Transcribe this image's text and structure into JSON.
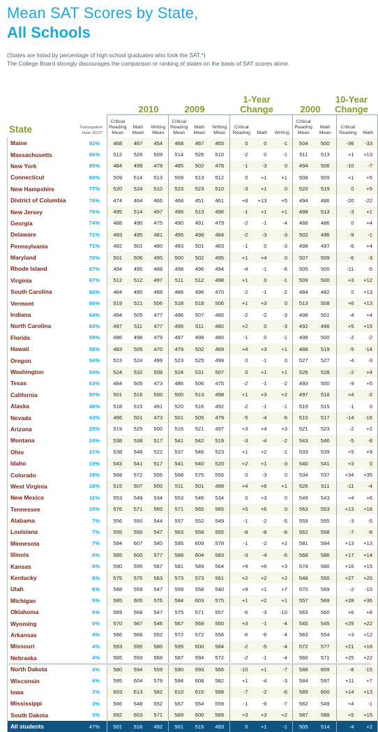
{
  "header": {
    "title_line1": "Mean SAT Scores by State,",
    "title_line2": "All Schools",
    "note_line1": "(States are listed by percentage of high school graduates who took the SAT.*)",
    "note_line2": "The College Board strongly discourages the comparison or ranking of states on the basis of SAT scores alone."
  },
  "colors": {
    "title": "#1aa8e0",
    "group_header": "#8a9a2a",
    "state_name": "#7a2315",
    "participation": "#1aa8e0",
    "total_row_bg": "#0f5584",
    "shade_row_bg": "#f6f7e9"
  },
  "table": {
    "group_headers": {
      "y2010": "2010",
      "y2009": "2009",
      "change1_line1": "1-Year",
      "change1_line2": "Change",
      "y2000": "2000",
      "change10_line1": "10-Year",
      "change10_line2": "Change"
    },
    "state_header": "State",
    "participation_header_line1": "Participation",
    "participation_header_line2": "Rate 2010*",
    "columns": {
      "cr_mean": [
        "Critical",
        "Reading",
        "Mean"
      ],
      "math_mean": [
        "Math",
        "Mean"
      ],
      "writing_mean": [
        "Writing",
        "Mean"
      ],
      "cr": [
        "Critical",
        "Reading"
      ],
      "math": "Math",
      "writing": "Writing"
    },
    "rows": [
      {
        "state": "Maine",
        "rate": "92%",
        "v": [
          "468",
          "467",
          "454",
          "468",
          "467",
          "455",
          "0",
          "0",
          "-1",
          "504",
          "500",
          "-36",
          "-33"
        ]
      },
      {
        "state": "Massachusetts",
        "rate": "86%",
        "v": [
          "512",
          "526",
          "509",
          "514",
          "526",
          "510",
          "-2",
          "0",
          "-1",
          "511",
          "513",
          "+1",
          "+13"
        ]
      },
      {
        "state": "New York",
        "rate": "85%",
        "v": [
          "484",
          "499",
          "478",
          "485",
          "502",
          "478",
          "-1",
          "-3",
          "0",
          "494",
          "506",
          "-10",
          "-7"
        ]
      },
      {
        "state": "Connecticut",
        "rate": "84%",
        "v": [
          "509",
          "514",
          "513",
          "509",
          "513",
          "512",
          "0",
          "+1",
          "+1",
          "508",
          "509",
          "+1",
          "+5"
        ]
      },
      {
        "state": "New Hampshire",
        "rate": "77%",
        "v": [
          "520",
          "524",
          "510",
          "523",
          "523",
          "510",
          "-3",
          "+1",
          "0",
          "520",
          "519",
          "0",
          "+5"
        ]
      },
      {
        "state": "District of Columbia",
        "rate": "76%",
        "v": [
          "474",
          "464",
          "466",
          "468",
          "451",
          "461",
          "+8",
          "+13",
          "+5",
          "494",
          "486",
          "-20",
          "-22"
        ]
      },
      {
        "state": "New Jersey",
        "rate": "76%",
        "v": [
          "495",
          "514",
          "497",
          "496",
          "513",
          "496",
          "-1",
          "+1",
          "+1",
          "498",
          "513",
          "-3",
          "+1"
        ]
      },
      {
        "state": "Georgia",
        "rate": "74%",
        "v": [
          "488",
          "490",
          "475",
          "490",
          "491",
          "479",
          "-2",
          "-1",
          "-4",
          "488",
          "486",
          "0",
          "+4"
        ]
      },
      {
        "state": "Delaware",
        "rate": "71%",
        "v": [
          "493",
          "495",
          "481",
          "495",
          "498",
          "484",
          "-2",
          "-3",
          "-3",
          "502",
          "496",
          "-9",
          "-1"
        ]
      },
      {
        "state": "Pennsylvania",
        "rate": "71%",
        "v": [
          "492",
          "501",
          "480",
          "493",
          "501",
          "483",
          "-1",
          "0",
          "-3",
          "498",
          "497",
          "-6",
          "+4"
        ]
      },
      {
        "state": "Maryland",
        "rate": "70%",
        "v": [
          "501",
          "506",
          "495",
          "500",
          "502",
          "495",
          "+1",
          "+4",
          "0",
          "507",
          "509",
          "-6",
          "-3"
        ]
      },
      {
        "state": "Rhode Island",
        "rate": "67%",
        "v": [
          "494",
          "495",
          "488",
          "498",
          "496",
          "494",
          "-4",
          "-1",
          "-6",
          "505",
          "500",
          "-11",
          "-5"
        ]
      },
      {
        "state": "Virginia",
        "rate": "67%",
        "v": [
          "512",
          "512",
          "497",
          "511",
          "512",
          "498",
          "+1",
          "0",
          "-1",
          "509",
          "500",
          "+3",
          "+12"
        ]
      },
      {
        "state": "South Carolina",
        "rate": "66%",
        "v": [
          "484",
          "495",
          "468",
          "486",
          "496",
          "470",
          "-2",
          "-1",
          "-2",
          "484",
          "482",
          "0",
          "+13"
        ]
      },
      {
        "state": "Vermont",
        "rate": "66%",
        "v": [
          "519",
          "521",
          "506",
          "518",
          "518",
          "506",
          "+1",
          "+3",
          "0",
          "513",
          "508",
          "+6",
          "+13"
        ]
      },
      {
        "state": "Indiana",
        "rate": "64%",
        "v": [
          "494",
          "505",
          "477",
          "496",
          "507",
          "480",
          "-2",
          "-2",
          "-3",
          "498",
          "501",
          "-4",
          "+4"
        ]
      },
      {
        "state": "North Carolina",
        "rate": "63%",
        "v": [
          "497",
          "511",
          "477",
          "495",
          "511",
          "480",
          "+2",
          "0",
          "-3",
          "492",
          "496",
          "+5",
          "+15"
        ]
      },
      {
        "state": "Florida",
        "rate": "59%",
        "v": [
          "496",
          "498",
          "479",
          "497",
          "498",
          "480",
          "-1",
          "0",
          "-1",
          "498",
          "500",
          "-2",
          "-2"
        ]
      },
      {
        "state": "Hawaii",
        "rate": "58%",
        "v": [
          "483",
          "505",
          "470",
          "479",
          "502",
          "469",
          "+4",
          "+3",
          "+1",
          "488",
          "519",
          "-5",
          "-14"
        ]
      },
      {
        "state": "Oregon",
        "rate": "54%",
        "v": [
          "523",
          "524",
          "499",
          "523",
          "525",
          "499",
          "0",
          "-1",
          "0",
          "527",
          "527",
          "-4",
          "-3"
        ]
      },
      {
        "state": "Washington",
        "rate": "54%",
        "v": [
          "524",
          "532",
          "508",
          "524",
          "531",
          "507",
          "0",
          "+1",
          "+1",
          "526",
          "528",
          "-2",
          "+4"
        ]
      },
      {
        "state": "Texas",
        "rate": "53%",
        "v": [
          "484",
          "505",
          "473",
          "486",
          "506",
          "475",
          "-2",
          "-1",
          "-2",
          "493",
          "500",
          "-9",
          "+5"
        ]
      },
      {
        "state": "California",
        "rate": "50%",
        "v": [
          "501",
          "516",
          "500",
          "500",
          "513",
          "498",
          "+1",
          "+3",
          "+2",
          "497",
          "518",
          "+4",
          "-2"
        ]
      },
      {
        "state": "Alaska",
        "rate": "48%",
        "v": [
          "518",
          "515",
          "491",
          "520",
          "516",
          "492",
          "-2",
          "-1",
          "-1",
          "519",
          "515",
          "-1",
          "0"
        ]
      },
      {
        "state": "Nevada",
        "rate": "43%",
        "v": [
          "496",
          "501",
          "473",
          "501",
          "505",
          "479",
          "-5",
          "-4",
          "-6",
          "510",
          "517",
          "-14",
          "-16"
        ]
      },
      {
        "state": "Arizona",
        "rate": "25%",
        "v": [
          "519",
          "525",
          "500",
          "516",
          "521",
          "497",
          "+3",
          "+4",
          "+3",
          "521",
          "523",
          "-2",
          "+2"
        ]
      },
      {
        "state": "Montana",
        "rate": "24%",
        "v": [
          "538",
          "538",
          "517",
          "541",
          "542",
          "519",
          "-3",
          "-4",
          "-2",
          "543",
          "546",
          "-5",
          "-8"
        ]
      },
      {
        "state": "Ohio",
        "rate": "21%",
        "v": [
          "538",
          "548",
          "522",
          "537",
          "546",
          "523",
          "+1",
          "+2",
          "-1",
          "533",
          "539",
          "+5",
          "+9"
        ]
      },
      {
        "state": "Idaho",
        "rate": "19%",
        "v": [
          "543",
          "541",
          "517",
          "541",
          "540",
          "520",
          "+2",
          "+1",
          "-3",
          "540",
          "541",
          "+3",
          "0"
        ]
      },
      {
        "state": "Colorado",
        "rate": "18%",
        "v": [
          "568",
          "572",
          "555",
          "568",
          "575",
          "555",
          "0",
          "-3",
          "0",
          "534",
          "537",
          "+34",
          "+35"
        ]
      },
      {
        "state": "West Virginia",
        "rate": "16%",
        "v": [
          "515",
          "507",
          "500",
          "511",
          "501",
          "499",
          "+4",
          "+6",
          "+1",
          "526",
          "511",
          "-11",
          "-4"
        ]
      },
      {
        "state": "New Mexico",
        "rate": "11%",
        "v": [
          "553",
          "549",
          "534",
          "553",
          "546",
          "534",
          "0",
          "+3",
          "0",
          "549",
          "543",
          "+4",
          "+6"
        ]
      },
      {
        "state": "Tennessee",
        "rate": "10%",
        "v": [
          "576",
          "571",
          "565",
          "571",
          "565",
          "565",
          "+5",
          "+6",
          "0",
          "563",
          "553",
          "+13",
          "+18"
        ]
      },
      {
        "state": "Alabama",
        "rate": "7%",
        "v": [
          "556",
          "550",
          "544",
          "557",
          "552",
          "549",
          "-1",
          "-2",
          "-5",
          "559",
          "555",
          "-3",
          "-5"
        ]
      },
      {
        "state": "Louisiana",
        "rate": "7%",
        "v": [
          "555",
          "550",
          "547",
          "563",
          "558",
          "555",
          "-8",
          "-8",
          "-8",
          "562",
          "558",
          "-7",
          "-8"
        ]
      },
      {
        "state": "Minnesota",
        "rate": "7%",
        "v": [
          "594",
          "607",
          "580",
          "595",
          "609",
          "578",
          "-1",
          "-2",
          "+2",
          "581",
          "594",
          "+13",
          "+13"
        ]
      },
      {
        "state": "Illinois",
        "rate": "6%",
        "v": [
          "585",
          "600",
          "577",
          "588",
          "604",
          "583",
          "-3",
          "-4",
          "-6",
          "568",
          "586",
          "+17",
          "+14"
        ]
      },
      {
        "state": "Kansas",
        "rate": "6%",
        "v": [
          "590",
          "595",
          "567",
          "581",
          "589",
          "564",
          "+9",
          "+6",
          "+3",
          "574",
          "580",
          "+16",
          "+15"
        ]
      },
      {
        "state": "Kentucky",
        "rate": "6%",
        "v": [
          "575",
          "575",
          "563",
          "573",
          "573",
          "561",
          "+2",
          "+2",
          "+2",
          "548",
          "550",
          "+27",
          "+25"
        ]
      },
      {
        "state": "Utah",
        "rate": "6%",
        "v": [
          "568",
          "559",
          "547",
          "559",
          "558",
          "540",
          "+9",
          "+1",
          "+7",
          "570",
          "569",
          "-2",
          "-10"
        ]
      },
      {
        "state": "Michigan",
        "rate": "5%",
        "v": [
          "585",
          "605",
          "576",
          "584",
          "603",
          "575",
          "+1",
          "+2",
          "+1",
          "557",
          "569",
          "+28",
          "+36"
        ]
      },
      {
        "state": "Oklahoma",
        "rate": "5%",
        "v": [
          "569",
          "568",
          "547",
          "575",
          "571",
          "557",
          "-6",
          "-3",
          "-10",
          "563",
          "560",
          "+6",
          "+8"
        ]
      },
      {
        "state": "Wyoming",
        "rate": "5%",
        "v": [
          "570",
          "567",
          "546",
          "567",
          "568",
          "550",
          "+3",
          "-1",
          "-4",
          "545",
          "545",
          "+25",
          "+22"
        ]
      },
      {
        "state": "Arkansas",
        "rate": "4%",
        "v": [
          "566",
          "566",
          "552",
          "572",
          "572",
          "556",
          "-6",
          "-6",
          "-4",
          "563",
          "554",
          "+3",
          "+12"
        ]
      },
      {
        "state": "Missouri",
        "rate": "4%",
        "v": [
          "593",
          "595",
          "580",
          "595",
          "600",
          "584",
          "-2",
          "-5",
          "-4",
          "572",
          "577",
          "+21",
          "+18"
        ]
      },
      {
        "state": "Nebraska",
        "rate": "4%",
        "v": [
          "585",
          "593",
          "568",
          "587",
          "594",
          "572",
          "-2",
          "-1",
          "-4",
          "560",
          "571",
          "+25",
          "+22"
        ]
      },
      {
        "state": "North Dakota",
        "rate": "4%",
        "v": [
          "580",
          "594",
          "559",
          "590",
          "593",
          "566",
          "-10",
          "+1",
          "-7",
          "588",
          "609",
          "-8",
          "-15"
        ]
      },
      {
        "state": "Wisconsin",
        "rate": "4%",
        "v": [
          "595",
          "604",
          "579",
          "594",
          "608",
          "582",
          "+1",
          "-4",
          "-3",
          "584",
          "597",
          "+11",
          "+7"
        ]
      },
      {
        "state": "Iowa",
        "rate": "3%",
        "v": [
          "603",
          "613",
          "582",
          "610",
          "615",
          "588",
          "-7",
          "-2",
          "-6",
          "589",
          "600",
          "+14",
          "+13"
        ]
      },
      {
        "state": "Mississippi",
        "rate": "3%",
        "v": [
          "566",
          "548",
          "552",
          "567",
          "554",
          "559",
          "-1",
          "-6",
          "-7",
          "562",
          "549",
          "+4",
          "-1"
        ]
      },
      {
        "state": "South Dakota",
        "rate": "3%",
        "v": [
          "592",
          "603",
          "571",
          "589",
          "600",
          "589",
          "+3",
          "+3",
          "+2",
          "587",
          "588",
          "+5",
          "+15"
        ]
      }
    ],
    "total": {
      "state": "All students",
      "rate": "47%",
      "v": [
        "501",
        "516",
        "492",
        "501",
        "515",
        "493",
        "0",
        "+1",
        "-1",
        "505",
        "514",
        "-4",
        "+2"
      ]
    }
  }
}
